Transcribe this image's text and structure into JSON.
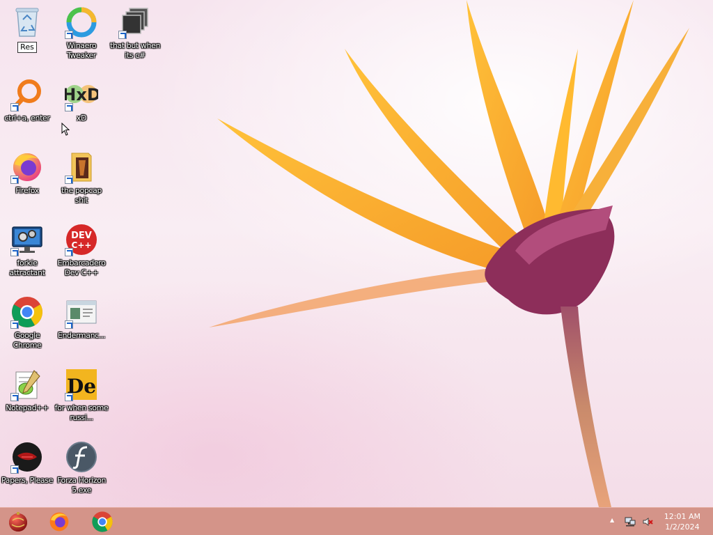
{
  "desktop": {
    "icons": [
      {
        "id": "recycle-bin",
        "label": "Res"
      },
      {
        "id": "winaero",
        "label": "Winaero Tweaker"
      },
      {
        "id": "that-but",
        "label": "that but when its c#"
      },
      {
        "id": "ctrl-a",
        "label": "ctrl+a, enter"
      },
      {
        "id": "xd",
        "label": "xD"
      },
      {
        "id": "firefox",
        "label": "Firefox"
      },
      {
        "id": "popcap",
        "label": "the popcap shit"
      },
      {
        "id": "forkie",
        "label": "forkie attractant"
      },
      {
        "id": "devcpp",
        "label": "Embarcadero Dev C++"
      },
      {
        "id": "chrome",
        "label": "Google Chrome"
      },
      {
        "id": "enderman",
        "label": "Endermanc..."
      },
      {
        "id": "notepadpp",
        "label": "Notepad++"
      },
      {
        "id": "russian",
        "label": "for when some russi..."
      },
      {
        "id": "papers",
        "label": "Papers, Please"
      },
      {
        "id": "forza",
        "label": "Forza Horizon 5.exe"
      }
    ],
    "icon_text": {
      "devcpp_top": "DEV",
      "devcpp_bottom": "C++",
      "russian_mark": "De",
      "xd_mark": "HxD"
    }
  },
  "taskbar": {
    "buttons": [
      "start-orb",
      "firefox",
      "chrome"
    ],
    "tray": {
      "chevron": "▲",
      "time": "12:01 AM",
      "date": "1/2/2024"
    },
    "colors": {
      "bar": "#d49489"
    }
  }
}
